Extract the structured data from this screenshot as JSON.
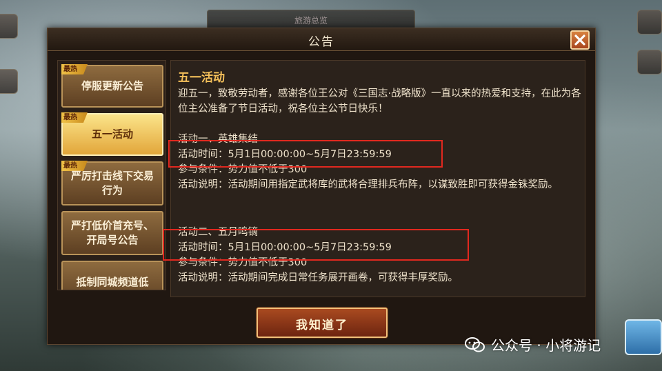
{
  "background": {
    "top_plate_text": "旅游总览"
  },
  "dialog": {
    "title": "公告",
    "close_icon": "close-icon",
    "tabs": [
      {
        "label": "停服更新公告",
        "badge": "最热",
        "active": false
      },
      {
        "label": "五一活动",
        "badge": "最热",
        "active": true
      },
      {
        "label": "严厉打击线下交易行为",
        "badge": "最热",
        "active": false
      },
      {
        "label": "严打低价首充号、开局号公告",
        "badge": "",
        "active": false
      },
      {
        "label": "抵制同城频道低",
        "badge": "",
        "active": false
      }
    ],
    "content": {
      "title": "五一活动",
      "intro": "迎五一，致敬劳动者，感谢各位王公对《三国志·战略版》一直以来的热爱和支持，在此为各位主公准备了节日活动，祝各位主公节日快乐！",
      "activity1": {
        "name": "活动一、英雄集结",
        "time": "活动时间：5月1日00:00:00~5月7日23:59:59",
        "condition": "参与条件：势力值不低于300",
        "desc": "活动说明：活动期间用指定武将库的武将合理排兵布阵，以谋致胜即可获得金铢奖励。"
      },
      "activity2": {
        "name": "活动二、五月鸣镝",
        "time": "活动时间：5月1日00:00:00~5月7日23:59:59",
        "condition": "参与条件：势力值不低于300",
        "desc": "活动说明：活动期间完成日常任务展开画卷，可获得丰厚奖励。"
      }
    },
    "confirm_label": "我知道了"
  },
  "watermark": {
    "text": "公众号 · 小将游记",
    "icon": "wechat-icon"
  },
  "colors": {
    "highlight_box": "#e2281f",
    "title_gold": "#f4c05a",
    "active_tab": "#f4c75a"
  }
}
